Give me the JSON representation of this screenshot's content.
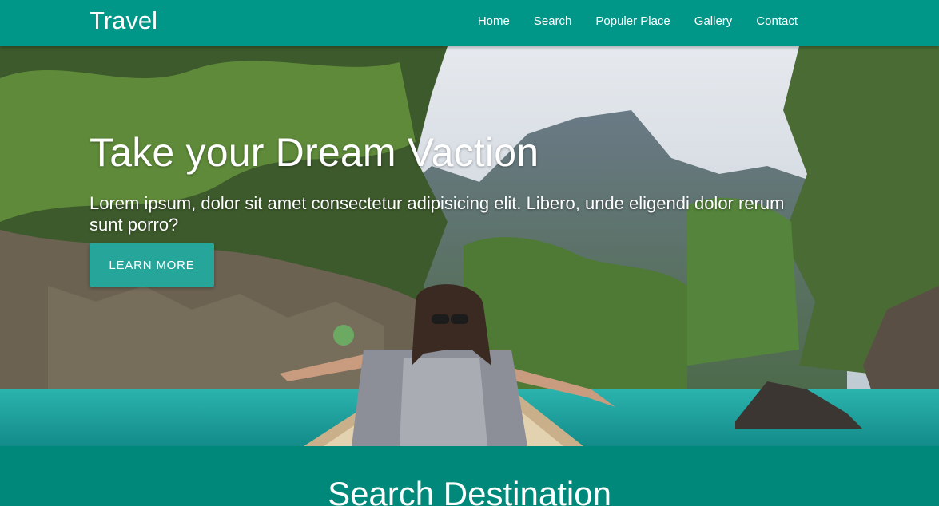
{
  "navbar": {
    "brand": "Travel",
    "links": [
      "Home",
      "Search",
      "Populer Place",
      "Gallery",
      "Contact"
    ]
  },
  "hero": {
    "title": "Take your Dream Vaction",
    "subtitle": "Lorem ipsum, dolor sit amet consectetur adipisicing elit. Libero, unde eligendi dolor rerum sunt porro?",
    "button_label": "LEARN MORE",
    "image": "woman-on-boat-tropical-lagoon"
  },
  "search_section": {
    "title": "Search Destination"
  },
  "colors": {
    "primary": "#009688",
    "button": "#26a69a",
    "section": "#00897b"
  }
}
